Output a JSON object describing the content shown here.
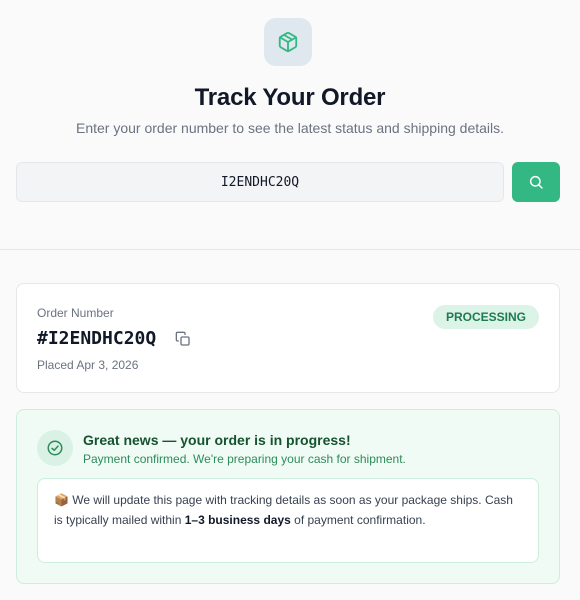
{
  "header": {
    "icon": "package-icon",
    "title": "Track Your Order",
    "subtitle": "Enter your order number to see the latest status and shipping details."
  },
  "search": {
    "value": "I2ENDHC20Q",
    "button_icon": "search-icon"
  },
  "order": {
    "label": "Order Number",
    "number": "#I2ENDHC20Q",
    "placed": "Placed Apr 3, 2026",
    "status": "PROCESSING",
    "copy_icon": "copy-icon"
  },
  "progress": {
    "icon": "check-circle-icon",
    "headline": "Great news — your order is in progress!",
    "subtext": "Payment confirmed. We're preparing your cash for shipment.",
    "note_emoji": "📦",
    "note_part1": "We will update this page with tracking details as soon as your package ships. Cash is typically mailed within",
    "note_bold": "1–3 business days",
    "note_part2": "of payment confirmation."
  },
  "colors": {
    "accent": "#34b883",
    "status_badge_bg": "#dcf3e7",
    "status_badge_text": "#1f7a4f",
    "progress_bg": "#f0fbf5"
  }
}
